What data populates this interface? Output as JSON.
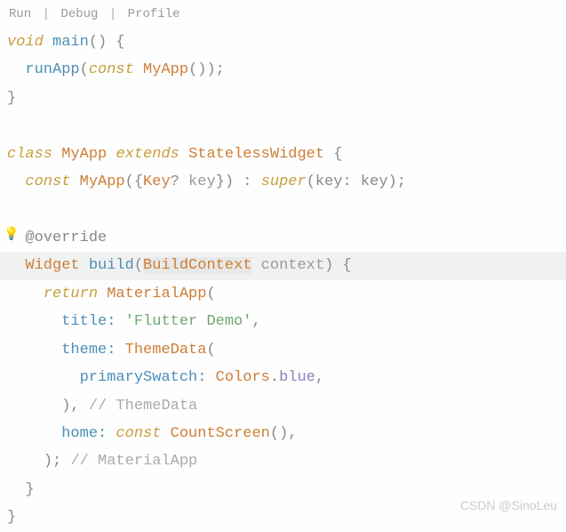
{
  "codelens": {
    "run": "Run",
    "debug": "Debug",
    "profile": "Profile"
  },
  "code": {
    "l1": {
      "void": "void",
      "main": "main",
      "rest": "() {"
    },
    "l2": {
      "fn": "runApp",
      "p1": "(",
      "const": "const",
      "cls": "MyApp",
      "p2": "());"
    },
    "l3": {
      "brace": "}"
    },
    "l5": {
      "class": "class",
      "name": "MyApp",
      "extends": "extends",
      "parent": "StatelessWidget",
      "brace": " {"
    },
    "l6": {
      "const": "const",
      "ctor": "MyApp",
      "p1": "({",
      "keytype": "Key",
      "q": "?",
      "keyname": " key",
      "p2": "}) : ",
      "super": "super",
      "p3": "(key: key);"
    },
    "l8": {
      "annotation": "@override"
    },
    "l9": {
      "widget": "Widget",
      "build": "build",
      "p1": "(",
      "ctx": "BuildContext",
      "param": " context",
      "p2": ") {"
    },
    "l10": {
      "return": "return",
      "cls": "MaterialApp",
      "p": "("
    },
    "l11": {
      "prop": "title:",
      "str": "'Flutter Demo'",
      "c": ","
    },
    "l12": {
      "prop": "theme:",
      "cls": "ThemeData",
      "p": "("
    },
    "l13": {
      "prop": "primarySwatch:",
      "cls": "Colors",
      "dot": ".",
      "val": "blue",
      "c": ","
    },
    "l14": {
      "close": "),",
      "hint": " // ThemeData"
    },
    "l15": {
      "prop": "home:",
      "const": "const",
      "cls": "CountScreen",
      "p": "(),"
    },
    "l16": {
      "close": ");",
      "hint": " // MaterialApp"
    },
    "l17": {
      "brace": "}"
    },
    "l18": {
      "brace": "}"
    }
  },
  "watermark": "CSDN @SinoLeu"
}
